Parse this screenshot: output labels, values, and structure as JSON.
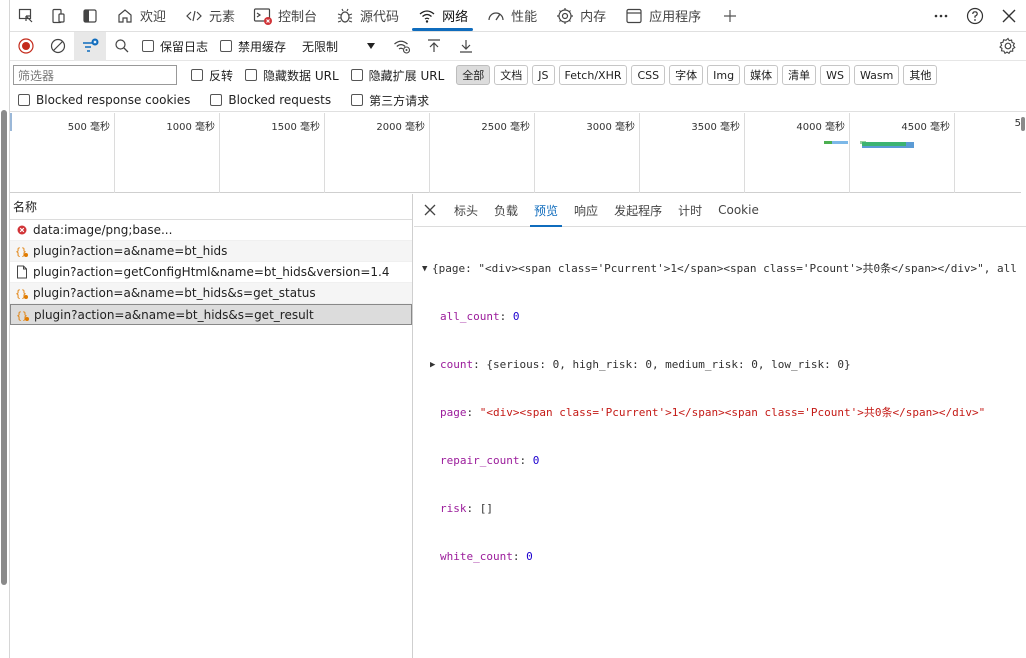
{
  "tabs": [
    {
      "label": "欢迎",
      "icon": "home-icon"
    },
    {
      "label": "元素",
      "icon": "code-icon"
    },
    {
      "label": "控制台",
      "icon": "console-icon"
    },
    {
      "label": "源代码",
      "icon": "bug-icon"
    },
    {
      "label": "网络",
      "icon": "wifi-icon",
      "active": true
    },
    {
      "label": "性能",
      "icon": "gauge-icon"
    },
    {
      "label": "内存",
      "icon": "memory-icon"
    },
    {
      "label": "应用程序",
      "icon": "app-icon"
    }
  ],
  "toolbar": {
    "preserve_log": "保留日志",
    "disable_cache": "禁用缓存",
    "throttle": "无限制"
  },
  "filters": {
    "placeholder": "筛选器",
    "invert": "反转",
    "hide_data_url": "隐藏数据 URL",
    "hide_ext_url": "隐藏扩展 URL",
    "types": [
      "全部",
      "文档",
      "JS",
      "Fetch/XHR",
      "CSS",
      "字体",
      "Img",
      "媒体",
      "清单",
      "WS",
      "Wasm",
      "其他"
    ],
    "blocked_cookies": "Blocked response cookies",
    "blocked_requests": "Blocked requests",
    "third_party": "第三方请求"
  },
  "overview": {
    "ticks": [
      "500 毫秒",
      "1000 毫秒",
      "1500 毫秒",
      "2000 毫秒",
      "2500 毫秒",
      "3000 毫秒",
      "3500 毫秒",
      "4000 毫秒",
      "4500 毫秒",
      "5"
    ]
  },
  "requests": {
    "header": "名称",
    "rows": [
      {
        "name": "data:image/png;base...",
        "icon": "error-icon"
      },
      {
        "name": "plugin?action=a&name=bt_hids",
        "icon": "xhr-icon"
      },
      {
        "name": "plugin?action=getConfigHtml&name=bt_hids&version=1.4",
        "icon": "document-icon"
      },
      {
        "name": "plugin?action=a&name=bt_hids&s=get_status",
        "icon": "xhr-icon"
      },
      {
        "name": "plugin?action=a&name=bt_hids&s=get_result",
        "icon": "xhr-icon",
        "selected": true
      }
    ]
  },
  "details": {
    "tabs": [
      "标头",
      "负载",
      "预览",
      "响应",
      "发起程序",
      "计时",
      "Cookie"
    ],
    "active": "预览",
    "preview": {
      "root": "{page: \"<div><span class='Pcurrent'>1</span><span class='Pcount'>共0条</span></div>\", all",
      "all_count_key": "all_count",
      "all_count": "0",
      "count_key": "count",
      "count_val": "{serious: 0, high_risk: 0, medium_risk: 0, low_risk: 0}",
      "page_key": "page",
      "page_val": "\"<div><span class='Pcurrent'>1</span><span class='Pcount'>共0条</span></div>\"",
      "repair_key": "repair_count",
      "repair_val": "0",
      "risk_key": "risk",
      "risk_val": "[]",
      "white_key": "white_count",
      "white_val": "0"
    }
  }
}
